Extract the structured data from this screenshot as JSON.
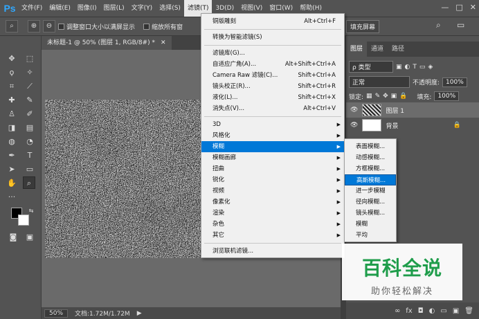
{
  "app": {
    "logo": "Ps"
  },
  "menubar": {
    "items": [
      "文件(F)",
      "编辑(E)",
      "图像(I)",
      "图层(L)",
      "文字(Y)",
      "选择(S)",
      "滤镜(T)",
      "3D(D)",
      "视图(V)",
      "窗口(W)",
      "帮助(H)"
    ],
    "window_controls": [
      "—",
      "□",
      "✕"
    ]
  },
  "options": {
    "resize_windows": "调整窗口大小以满屏显示",
    "zoom_all": "缩放所有窗",
    "fill_screen": "填充屏幕"
  },
  "document": {
    "tab": "未标题-1 @ 50% (图层 1, RGB/8#) *"
  },
  "status": {
    "zoom": "50%",
    "doc": "文档:1.72M/1.72M"
  },
  "filter_menu": {
    "items": [
      {
        "label": "铜版雕刻",
        "shortcut": "Alt+Ctrl+F",
        "arrow": ""
      },
      {
        "label": "转换为智能滤镜(S)",
        "shortcut": "",
        "arrow": ""
      },
      {
        "label": "滤镜库(G)...",
        "shortcut": "",
        "arrow": ""
      },
      {
        "label": "自适应广角(A)...",
        "shortcut": "Alt+Shift+Ctrl+A",
        "arrow": ""
      },
      {
        "label": "Camera Raw 滤镜(C)...",
        "shortcut": "Shift+Ctrl+A",
        "arrow": ""
      },
      {
        "label": "镜头校正(R)...",
        "shortcut": "Shift+Ctrl+R",
        "arrow": ""
      },
      {
        "label": "液化(L)...",
        "shortcut": "Shift+Ctrl+X",
        "arrow": ""
      },
      {
        "label": "消失点(V)...",
        "shortcut": "Alt+Ctrl+V",
        "arrow": ""
      },
      {
        "label": "3D",
        "shortcut": "",
        "arrow": "▶"
      },
      {
        "label": "风格化",
        "shortcut": "",
        "arrow": "▶"
      },
      {
        "label": "模糊",
        "shortcut": "",
        "arrow": "▶"
      },
      {
        "label": "模糊画廊",
        "shortcut": "",
        "arrow": "▶"
      },
      {
        "label": "扭曲",
        "shortcut": "",
        "arrow": "▶"
      },
      {
        "label": "锐化",
        "shortcut": "",
        "arrow": "▶"
      },
      {
        "label": "视频",
        "shortcut": "",
        "arrow": "▶"
      },
      {
        "label": "像素化",
        "shortcut": "",
        "arrow": "▶"
      },
      {
        "label": "渲染",
        "shortcut": "",
        "arrow": "▶"
      },
      {
        "label": "杂色",
        "shortcut": "",
        "arrow": "▶"
      },
      {
        "label": "其它",
        "shortcut": "",
        "arrow": "▶"
      },
      {
        "label": "浏览联机滤镜...",
        "shortcut": "",
        "arrow": ""
      }
    ]
  },
  "blur_submenu": {
    "items": [
      "表面模糊...",
      "动感模糊...",
      "方框模糊...",
      "高斯模糊...",
      "进一步模糊",
      "径向模糊...",
      "镜头模糊...",
      "模糊",
      "平均"
    ]
  },
  "layers_panel": {
    "tabs": [
      "图层",
      "通道",
      "路径"
    ],
    "filter_kind": "ρ 类型",
    "blend_mode": "正常",
    "opacity_label": "不透明度:",
    "opacity_value": "100%",
    "lock_label": "锁定:",
    "fill_label": "填充:",
    "fill_value": "100%",
    "layers": [
      {
        "name": "图层 1"
      },
      {
        "name": "背景"
      }
    ],
    "footer_icons": [
      "∞",
      "fx",
      "◘",
      "◐",
      "▭",
      "▣",
      "🗑"
    ]
  },
  "watermark": {
    "title": "百科全说",
    "subtitle": "助你轻松解决"
  }
}
